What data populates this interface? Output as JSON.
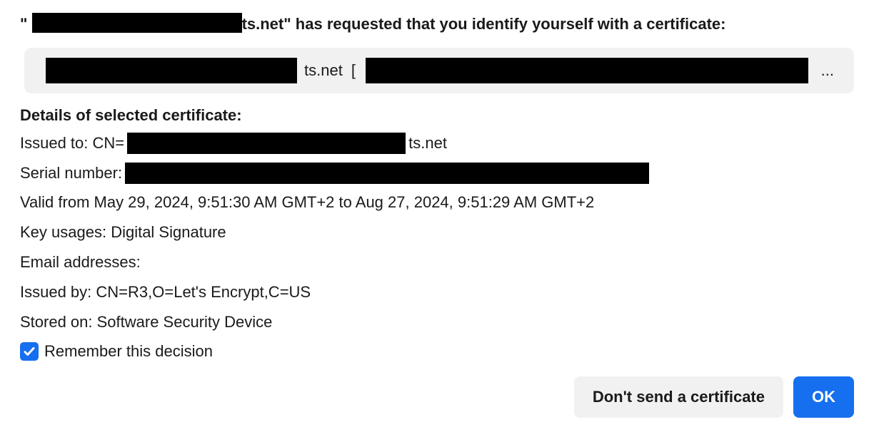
{
  "header": {
    "prefix_quote": "\"",
    "domain_suffix": "ts.net",
    "text_after": "\" has requested that you identify yourself with a certificate:"
  },
  "selected_cert": {
    "domain_suffix": "ts.net",
    "bracket": "[",
    "ellipsis": "..."
  },
  "details": {
    "title": "Details of selected certificate:",
    "issued_to_label": "Issued to: CN=",
    "issued_to_suffix": "ts.net",
    "serial_label": "Serial number:",
    "valid": "Valid from May 29, 2024, 9:51:30 AM GMT+2 to Aug 27, 2024, 9:51:29 AM GMT+2",
    "key_usages": "Key usages: Digital Signature",
    "email_addresses": "Email addresses:",
    "issued_by": "Issued by: CN=R3,O=Let's Encrypt,C=US",
    "stored_on": "Stored on: Software Security Device"
  },
  "remember": {
    "label": "Remember this decision",
    "checked": true
  },
  "buttons": {
    "dont_send": "Don't send a certificate",
    "ok": "OK"
  }
}
